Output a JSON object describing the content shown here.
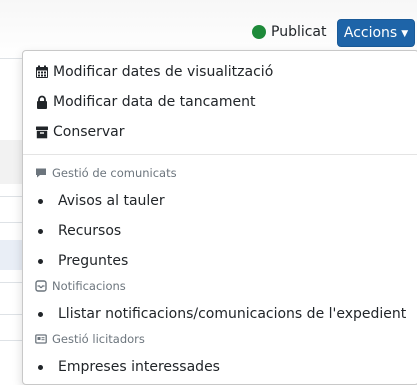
{
  "status": {
    "label": "Publicat",
    "color": "#1e8a3a"
  },
  "actions_button": {
    "label": "Accions"
  },
  "menu": {
    "top_items": [
      {
        "label": "Modificar dates de visualització",
        "icon": "calendar-icon"
      },
      {
        "label": "Modificar data de tancament",
        "icon": "lock-icon"
      },
      {
        "label": "Conservar",
        "icon": "archive-icon"
      }
    ],
    "sections": [
      {
        "header": "Gestió de comunicats",
        "icon": "comment-icon",
        "items": [
          "Avisos al tauler",
          "Recursos",
          "Preguntes"
        ]
      },
      {
        "header": "Notificacions",
        "icon": "envelope-open-icon",
        "items": [
          "Llistar notificacions/comunicacions de l'expedient"
        ]
      },
      {
        "header": "Gestió licitadors",
        "icon": "id-card-icon",
        "items": [
          "Empreses interessades"
        ]
      }
    ]
  }
}
